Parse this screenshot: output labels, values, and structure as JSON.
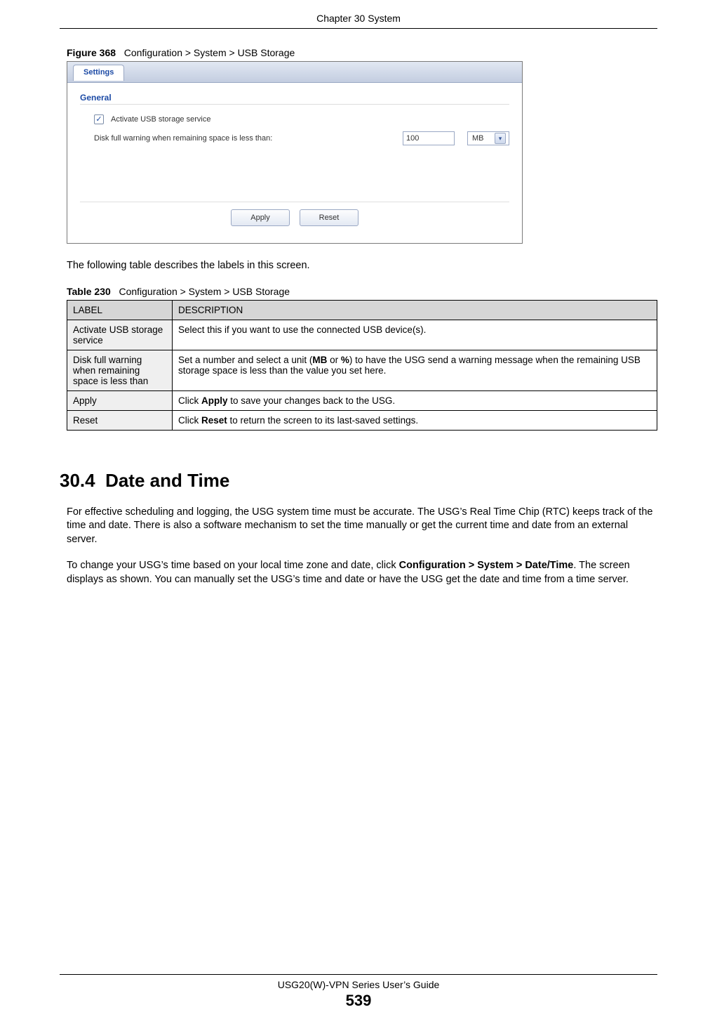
{
  "header": {
    "chapter": "Chapter 30 System"
  },
  "figure": {
    "label": "Figure 368",
    "title": "Configuration > System > USB Storage"
  },
  "screenshot": {
    "tab": "Settings",
    "section": "General",
    "checkbox_label": "Activate USB storage service",
    "checkbox_checked": "✓",
    "disk_full_label": "Disk full warning when remaining space is less than:",
    "value": "100",
    "unit": "MB",
    "apply": "Apply",
    "reset": "Reset"
  },
  "intro_para": "The following table describes the labels in this screen.",
  "table": {
    "label": "Table 230",
    "title": "Configuration > System > USB Storage",
    "head": {
      "c1": "LABEL",
      "c2": "DESCRIPTION"
    },
    "rows": [
      {
        "label": "Activate USB storage service",
        "desc_pre": "Select this if you want to use the connected USB device(s).",
        "b1": "",
        "mid": "",
        "b2": "",
        "post": ""
      },
      {
        "label": "Disk full warning when remaining space is less than",
        "desc_pre": "Set a number and select a unit (",
        "b1": "MB",
        "mid": " or ",
        "b2": "%",
        "post": ") to have the USG send a warning message when the remaining USB storage space is less than the value you set here."
      },
      {
        "label": "Apply",
        "desc_pre": "Click ",
        "b1": "Apply",
        "mid": "",
        "b2": "",
        "post": " to save your changes back to the USG."
      },
      {
        "label": "Reset",
        "desc_pre": "Click ",
        "b1": "Reset",
        "mid": "",
        "b2": "",
        "post": " to return the screen to its last-saved settings."
      }
    ]
  },
  "section": {
    "num": "30.4",
    "title": "Date and Time"
  },
  "body": {
    "p1": "For effective scheduling and logging, the USG system time must be accurate. The USG’s Real Time Chip (RTC) keeps track of the time and date. There is also a software mechanism to set the time manually or get the current time and date from an external server.",
    "p2_pre": "To change your USG’s time based on your local time zone and date, click ",
    "p2_bold": "Configuration > System > Date/Time",
    "p2_post": ". The screen displays as shown. You can manually set the USG’s time and date or have the USG get the date and time from a time server."
  },
  "footer": {
    "guide": "USG20(W)-VPN Series User’s Guide",
    "page": "539"
  }
}
